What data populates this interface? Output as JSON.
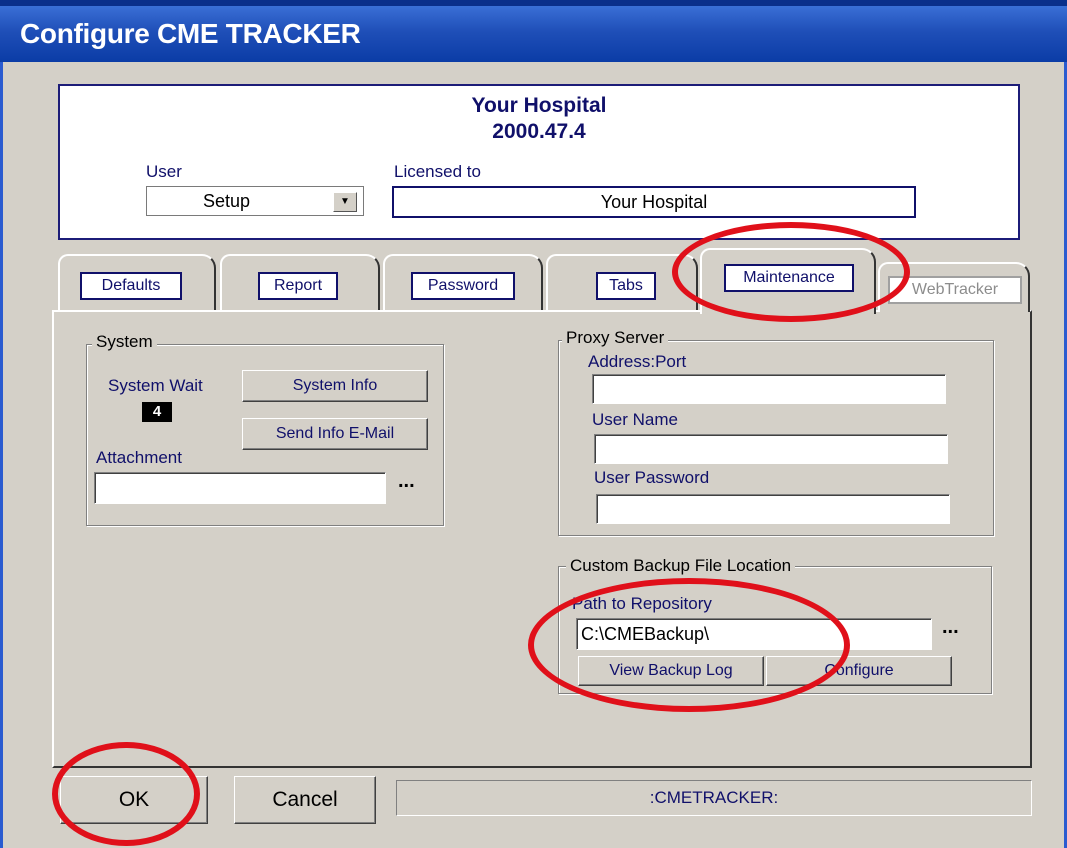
{
  "window": {
    "title": "Configure CME TRACKER"
  },
  "header": {
    "hospital": "Your Hospital",
    "version": "2000.47.4",
    "user_label": "User",
    "user_value": "Setup",
    "licensed_label": "Licensed to",
    "licensed_value": "Your Hospital"
  },
  "tabs": [
    {
      "label": "Defaults"
    },
    {
      "label": "Report"
    },
    {
      "label": "Password"
    },
    {
      "label": "Tabs"
    },
    {
      "label": "Maintenance",
      "active": true
    },
    {
      "label": "WebTracker",
      "disabled": true
    }
  ],
  "system": {
    "title": "System",
    "system_wait_label": "System Wait",
    "system_wait_value": "4",
    "system_info_button": "System Info",
    "send_info_button": "Send Info E-Mail",
    "attachment_label": "Attachment",
    "attachment_value": "",
    "browse_label": "..."
  },
  "proxy": {
    "title": "Proxy Server",
    "address_label": "Address:Port",
    "address_value": "",
    "username_label": "User Name",
    "username_value": "",
    "password_label": "User Password",
    "password_value": ""
  },
  "backup": {
    "title": "Custom Backup File Location",
    "path_label": "Path to Repository",
    "path_value": "C:\\CMEBackup\\",
    "browse_label": "...",
    "view_log_button": "View Backup Log",
    "configure_button": "Configure"
  },
  "footer": {
    "ok_button": "OK",
    "cancel_button": "Cancel",
    "status_text": ":CMETRACKER:"
  },
  "colors": {
    "titlebar": "#0b3ca6",
    "dialog_bg": "#d4d0c8",
    "label_blue": "#10106a",
    "annotation_red": "#e0101a"
  }
}
